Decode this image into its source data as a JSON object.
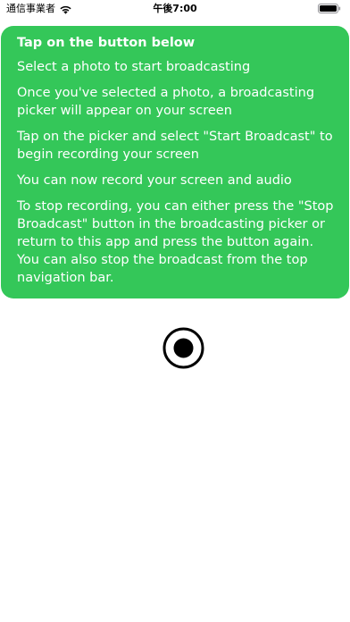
{
  "status_bar": {
    "carrier": "通信事業者",
    "time": "午後7:00"
  },
  "card": {
    "title": "Tap on the button below",
    "steps": [
      "Select a photo to start broadcasting",
      "Once you've selected a photo, a broadcasting picker will appear on your screen",
      "Tap on the picker and select \"Start Broadcast\" to begin recording your screen",
      "You can now record your screen and audio",
      "To stop recording, you can either press the \"Stop Broadcast\" button in the broadcasting picker or return to this app and press the button again. You can also stop the broadcast from the top navigation bar."
    ],
    "background_color": "#34C759",
    "text_color": "#FFFFFF"
  },
  "record_button": {
    "icon": "record-icon"
  }
}
